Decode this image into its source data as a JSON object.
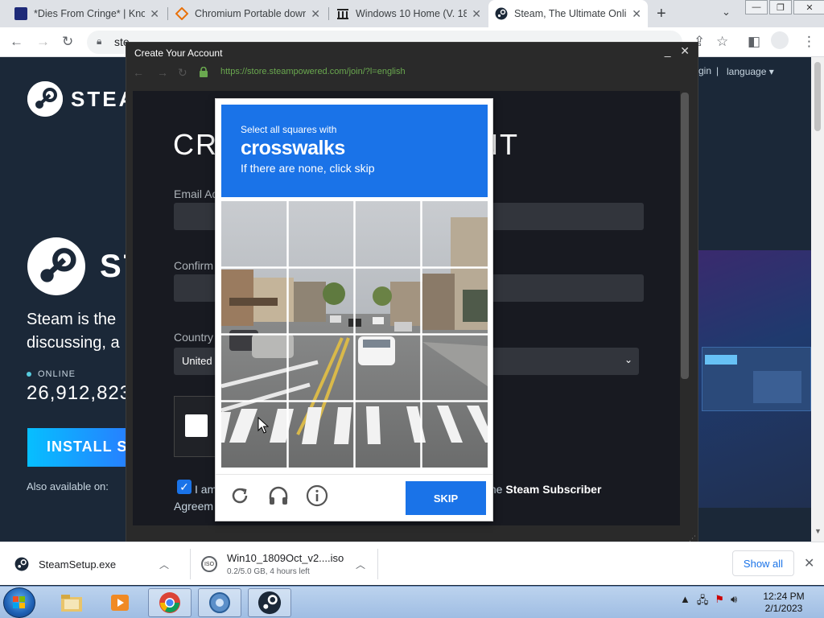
{
  "browser": {
    "tabs": [
      {
        "title": "*Dies From Cringe* | Kno",
        "favicon_color": "#1e2a78"
      },
      {
        "title": "Chromium Portable down",
        "favicon_color": "#e8710a"
      },
      {
        "title": "Windows 10 Home (V. 18",
        "favicon_color": "#222222"
      },
      {
        "title": "Steam, The Ultimate Onli",
        "favicon_color": "#1b2838"
      }
    ],
    "new_tab": "+",
    "address": "ste",
    "colors": {
      "accent": "#1a73e8"
    }
  },
  "steam": {
    "brand_top": "STEA",
    "brand_mid": "ST",
    "nav_login": "gin",
    "nav_sep": "|",
    "language": "language",
    "hero_line1": "Steam is the",
    "hero_line2": "discussing, a",
    "online_label": "ONLINE",
    "online_count": "26,912,823",
    "install_label": "INSTALL ST",
    "also_available": "Also available on:"
  },
  "popup": {
    "title": "Create Your Account",
    "url": "https://store.steampowered.com/join/?l=english",
    "heading_left": "CRE",
    "heading_right": "NT",
    "email_label": "Email Ad",
    "confirm_label": "Confirm",
    "country_label": "Country",
    "country_value": "United",
    "agree_left": "I am",
    "agree_right_plain": "the",
    "agree_right_bold": "Steam Subscriber",
    "agree_line2": "Agreem"
  },
  "captcha": {
    "instruction": "Select all squares with",
    "target": "crosswalks",
    "hint": "If there are none, click skip",
    "skip_label": "SKIP",
    "icons": [
      "refresh-icon",
      "headphones-icon",
      "info-icon"
    ]
  },
  "downloads": {
    "items": [
      {
        "name": "SteamSetup.exe",
        "sub": ""
      },
      {
        "name": "Win10_1809Oct_v2....iso",
        "sub": "0.2/5.0 GB, 4 hours left"
      }
    ],
    "show_all": "Show all"
  },
  "taskbar": {
    "time": "12:24 PM",
    "date": "2/1/2023"
  }
}
